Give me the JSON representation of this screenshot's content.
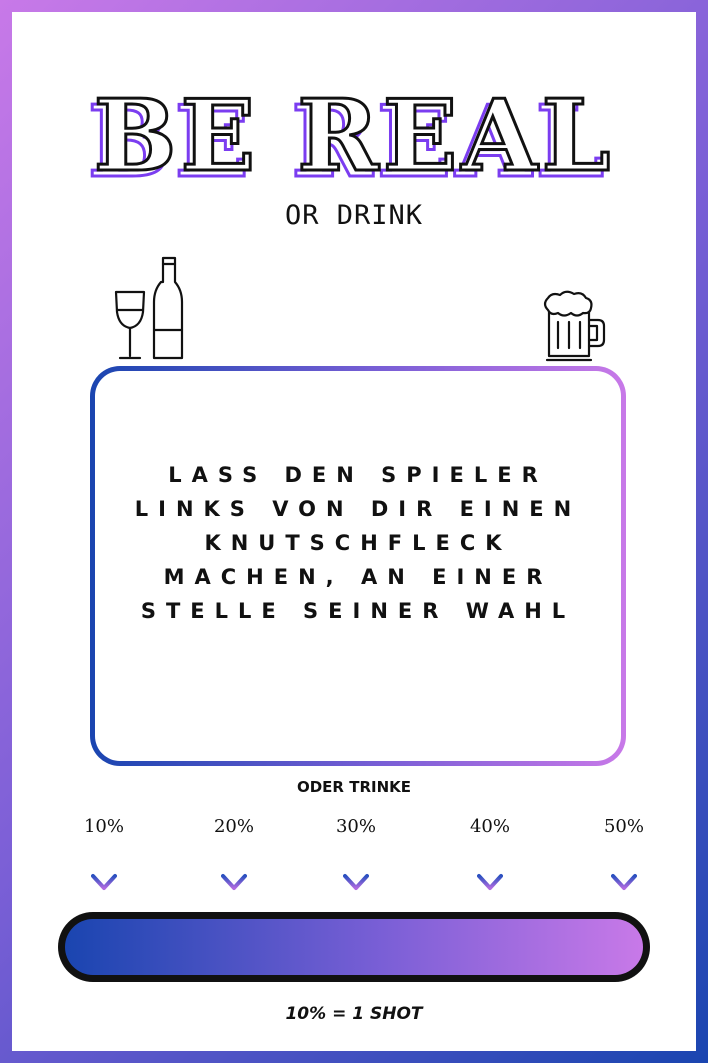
{
  "title": "BE REAL",
  "subtitle": "OR DRINK",
  "card": {
    "text": "Lass den Spieler links von dir einen Knutschfleck machen, an einer Stelle seiner Wahl"
  },
  "or_drink_label": "ODER TRINKE",
  "scale": {
    "markers": [
      "10%",
      "20%",
      "30%",
      "40%",
      "50%"
    ],
    "fill_fraction": 1.0
  },
  "footer": "10% = 1 SHOT",
  "icons": {
    "left": "wine-glass-and-bottle-icon",
    "right": "beer-mug-icon",
    "marker": "arrow-down-icon"
  },
  "colors": {
    "gradient_start": "#1a45b0",
    "gradient_mid": "#7a5fd6",
    "gradient_end": "#c879e8",
    "title_shadow": "#7b3df0",
    "text": "#111111"
  }
}
